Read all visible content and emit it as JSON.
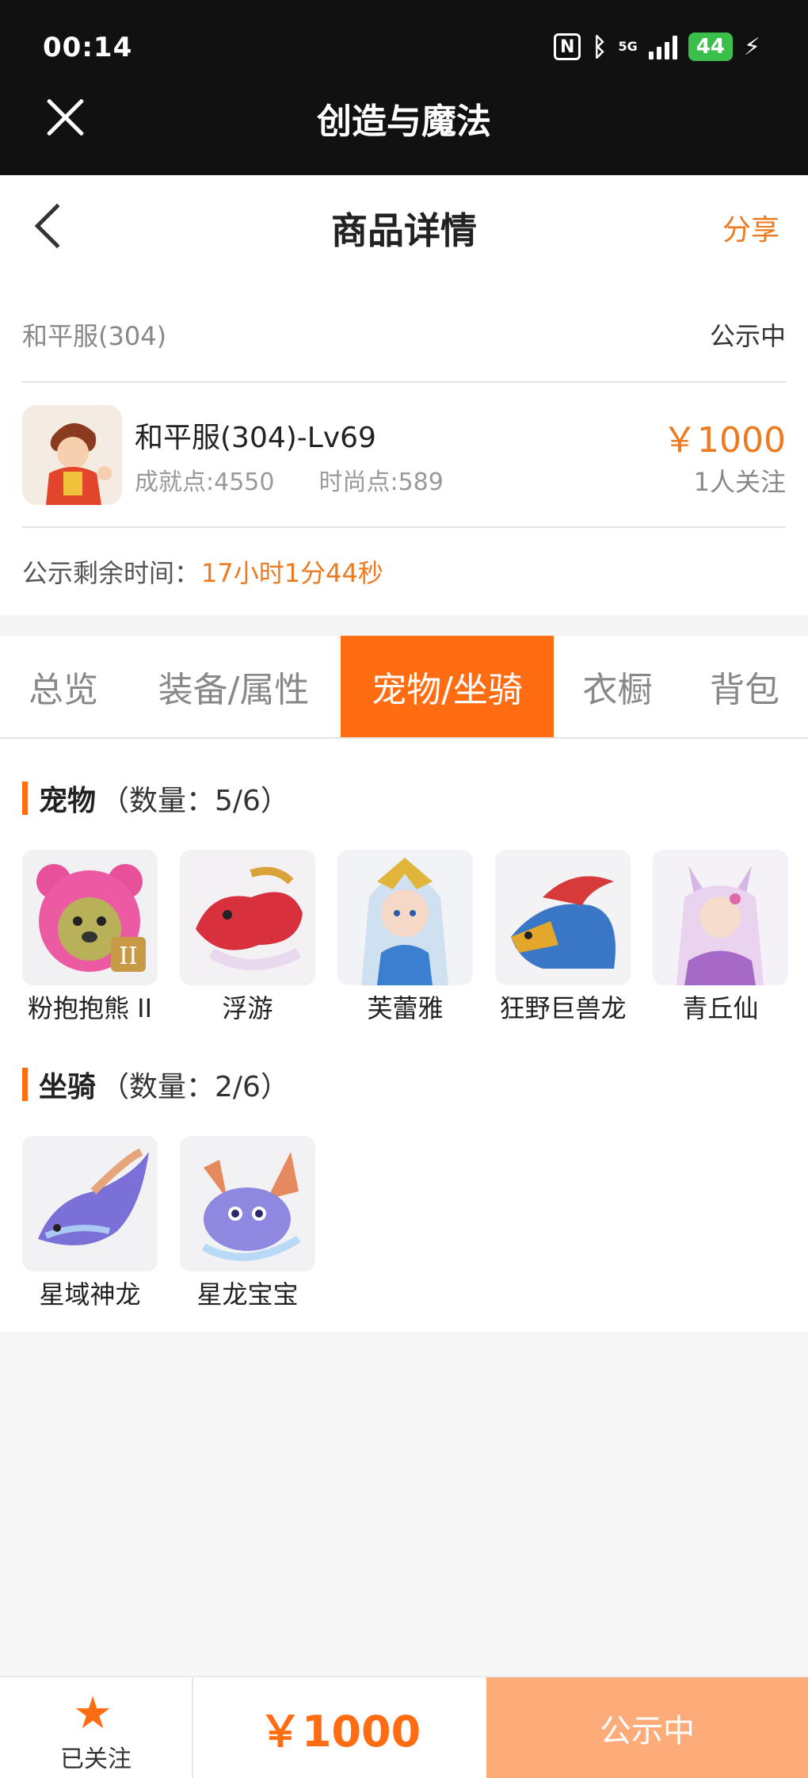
{
  "status_bar": {
    "time": "00:14",
    "network": "5G",
    "battery": "44"
  },
  "app_bar": {
    "title": "创造与魔法"
  },
  "nav": {
    "title": "商品详情",
    "share": "分享"
  },
  "listing": {
    "server": "和平服(304)",
    "status": "公示中",
    "name": "和平服(304)-Lv69",
    "achievement_points": "成就点:4550",
    "fashion_points": "时尚点:589",
    "price": "￥1000",
    "followers": "1人关注",
    "countdown_label": "公示剩余时间：",
    "countdown_value": "17小时1分44秒"
  },
  "tabs": [
    {
      "label": "总览",
      "active": false
    },
    {
      "label": "装备/属性",
      "active": false
    },
    {
      "label": "宠物/坐骑",
      "active": true
    },
    {
      "label": "衣橱",
      "active": false
    },
    {
      "label": "背包",
      "active": false
    }
  ],
  "pets": {
    "title": "宠物",
    "count": "（数量：5/6）",
    "items": [
      {
        "label": "粉抱抱熊 II"
      },
      {
        "label": "浮游"
      },
      {
        "label": "芙蕾雅"
      },
      {
        "label": "狂野巨兽龙"
      },
      {
        "label": "青丘仙"
      }
    ]
  },
  "mounts": {
    "title": "坐骑",
    "count": "（数量：2/6）",
    "items": [
      {
        "label": "星域神龙"
      },
      {
        "label": "星龙宝宝"
      }
    ]
  },
  "bottom_bar": {
    "follow_label": "已关注",
    "price": "￥1000",
    "status": "公示中"
  },
  "colors": {
    "accent": "#ff6c12",
    "price": "#ee7a1f",
    "status_button": "#fdab79"
  }
}
